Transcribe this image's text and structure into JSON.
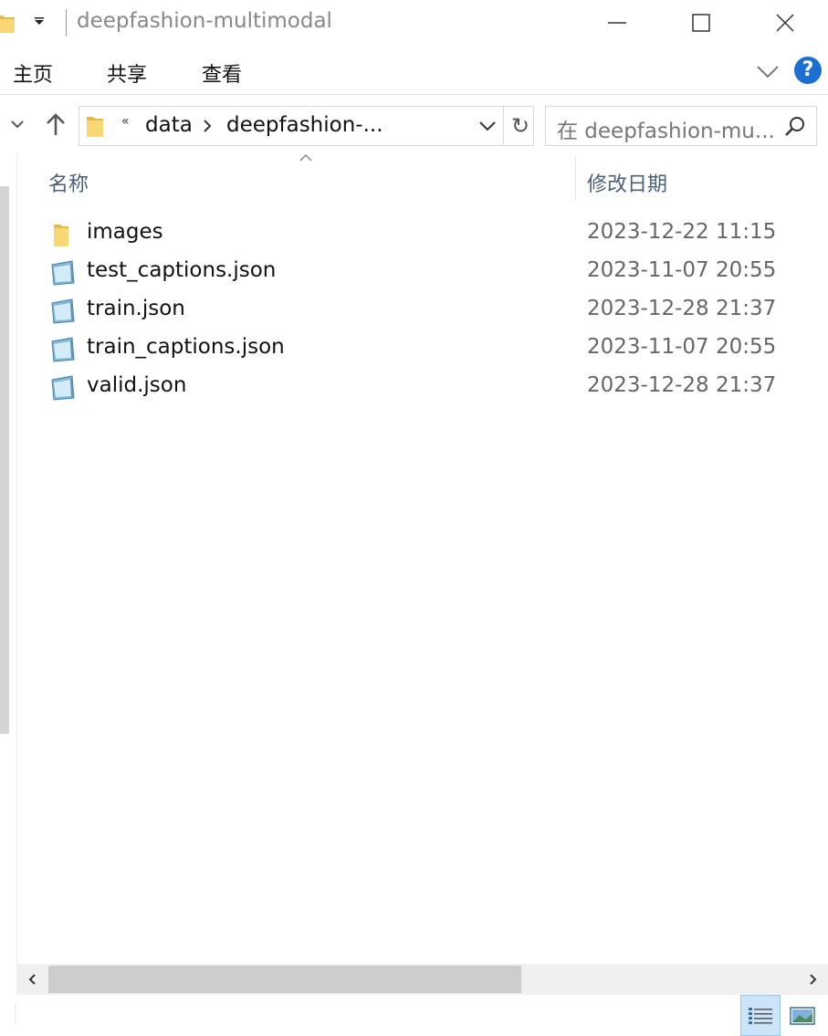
{
  "window": {
    "title": "deepfashion-multimodal"
  },
  "ribbon": {
    "tabs": [
      "主页",
      "共享",
      "查看"
    ],
    "help_label": "?"
  },
  "nav": {
    "overflow_label": "«",
    "breadcrumbs": [
      "data",
      "deepfashion-..."
    ],
    "refresh_label": "↻",
    "search_placeholder": "在 deepfashion-mu..."
  },
  "columns": {
    "name": "名称",
    "date_modified": "修改日期"
  },
  "files": [
    {
      "name": "images",
      "date": "2023-12-22 11:15",
      "icon": "folder-icon"
    },
    {
      "name": "test_captions.json",
      "date": "2023-11-07 20:55",
      "icon": "json-file-icon"
    },
    {
      "name": "train.json",
      "date": "2023-12-28 21:37",
      "icon": "json-file-icon"
    },
    {
      "name": "train_captions.json",
      "date": "2023-11-07 20:55",
      "icon": "json-file-icon"
    },
    {
      "name": "valid.json",
      "date": "2023-12-28 21:37",
      "icon": "json-file-icon"
    }
  ],
  "colors": {
    "accent": "#1a6fd1",
    "header_text": "#4c607a",
    "selected_view": "#cce4f7",
    "folder": "#f8d775"
  }
}
